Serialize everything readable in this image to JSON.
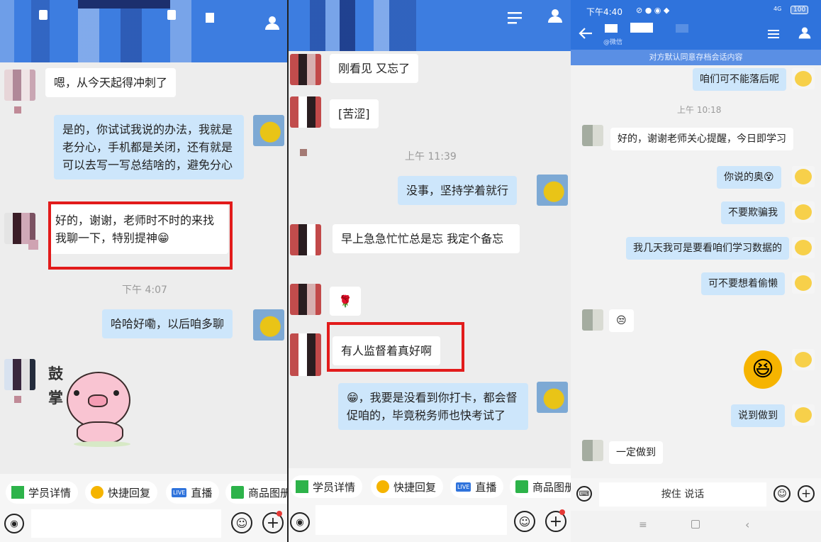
{
  "colors": {
    "header": "#3d7de0",
    "header_p3": "#2f73dc",
    "bubble_blue": "#cde6fb",
    "highlight": "#e21b1b"
  },
  "panel1": {
    "messages": [
      {
        "text": "嗯，从今天起得冲刺了"
      },
      {
        "text": "是的，你试试我说的办法，我就是老分心，手机都是关闭，还有就是可以去写一写总结啥的，避免分心"
      },
      {
        "text": "好的，谢谢，老师时不时的来找我聊一下，特别提神😁"
      },
      {
        "text": "哈哈好嘞，以后咱多聊"
      }
    ],
    "time": "下午 4:07",
    "sticker_text": "鼓掌",
    "chips": [
      "学员详情",
      "快捷回复",
      "直播",
      "商品图册"
    ],
    "live_badge": "LIVE"
  },
  "panel2": {
    "messages": [
      {
        "text": "刚看见  又忘了"
      },
      {
        "text": "[苦涩]"
      },
      {
        "text": "没事，坚持学着就行"
      },
      {
        "text": "早上急急忙忙总是忘  我定个备忘"
      },
      {
        "text": "🌹"
      },
      {
        "text": "有人监督着真好啊"
      },
      {
        "text": "😁，我要是没看到你打卡，都会督促咱的，毕竟税务师也快考试了"
      }
    ],
    "time": "上午 11:39",
    "chips": [
      "学员详情",
      "快捷回复",
      "直播",
      "商品图册"
    ],
    "live_badge": "LIVE"
  },
  "panel3": {
    "status": {
      "time": "下午4:40",
      "network": "4G",
      "battery": "100"
    },
    "subtitle": "@微信",
    "notice": "对方默认同意存档会话内容",
    "time": "上午 10:18",
    "messages": [
      {
        "text": "咱们可不能落后呢"
      },
      {
        "text": "好的，谢谢老师关心提醒，今日即学习"
      },
      {
        "text": "你说的奥😵"
      },
      {
        "text": "不要欺骗我"
      },
      {
        "text": "我几天我可是要看咱们学习数据的"
      },
      {
        "text": "可不要想着偷懒"
      },
      {
        "text": "😒"
      },
      {
        "text": "😆"
      },
      {
        "text": "说到做到"
      },
      {
        "text": "一定做到"
      }
    ],
    "hold_to_talk": "按住 说话"
  },
  "icons": [
    "person-icon",
    "back-arrow-icon",
    "menu-icon",
    "voice-icon",
    "emoji-icon",
    "plus-icon",
    "keyboard-icon",
    "nav-menu-icon",
    "nav-home-icon",
    "nav-back-icon"
  ]
}
